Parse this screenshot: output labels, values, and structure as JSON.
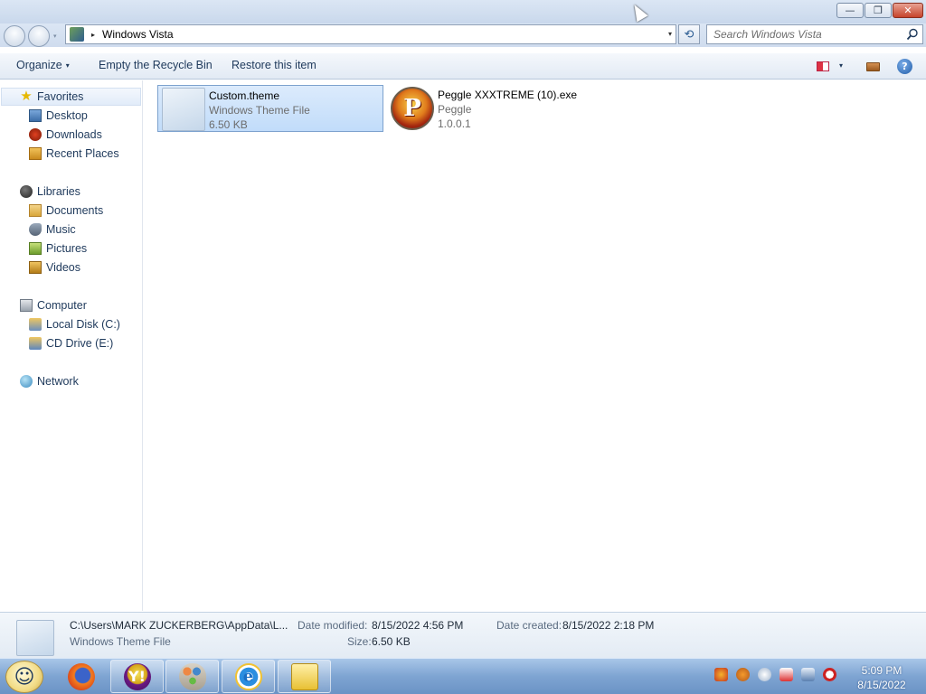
{
  "window": {
    "min_glyph": "—",
    "max_glyph": "❐",
    "close_glyph": "✕"
  },
  "address_bar": {
    "path": "Windows Vista",
    "separator": "▸",
    "dropdown": "▾",
    "refresh_glyph": "⟲"
  },
  "search": {
    "placeholder": "Search Windows Vista"
  },
  "toolbar": {
    "organize": "Organize",
    "empty_recycle_bin": "Empty the Recycle Bin",
    "restore_item": "Restore this item",
    "caret": "▾",
    "help": "?"
  },
  "nav": {
    "favorites": "Favorites",
    "desktop": "Desktop",
    "downloads": "Downloads",
    "recent_places": "Recent Places",
    "libraries": "Libraries",
    "documents": "Documents",
    "music": "Music",
    "pictures": "Pictures",
    "videos": "Videos",
    "computer": "Computer",
    "local_disk": "Local Disk (C:)",
    "cd_drive": "CD Drive (E:)",
    "network": "Network"
  },
  "files": [
    {
      "name": "Custom.theme",
      "type": "Windows Theme File",
      "detail": "6.50 KB"
    },
    {
      "name": "Peggle XXXTREME (10).exe",
      "type": "Peggle",
      "detail": "1.0.0.1",
      "icon_letter": "P"
    }
  ],
  "details": {
    "path": "C:\\Users\\MARK ZUCKERBERG\\AppData\\L...",
    "type": "Windows Theme File",
    "date_modified_label": "Date modified:",
    "date_modified": "8/15/2022 4:56 PM",
    "size_label": "Size:",
    "size": "6.50 KB",
    "date_created_label": "Date created:",
    "date_created": "8/15/2022 2:18 PM"
  },
  "taskbar": {
    "yahoo_letter": "Y!",
    "ie_letter": "e",
    "time": "5:09 PM",
    "date": "8/15/2022"
  },
  "colors": {
    "accent": "#1e395b",
    "selection": "#c1dcfa"
  }
}
